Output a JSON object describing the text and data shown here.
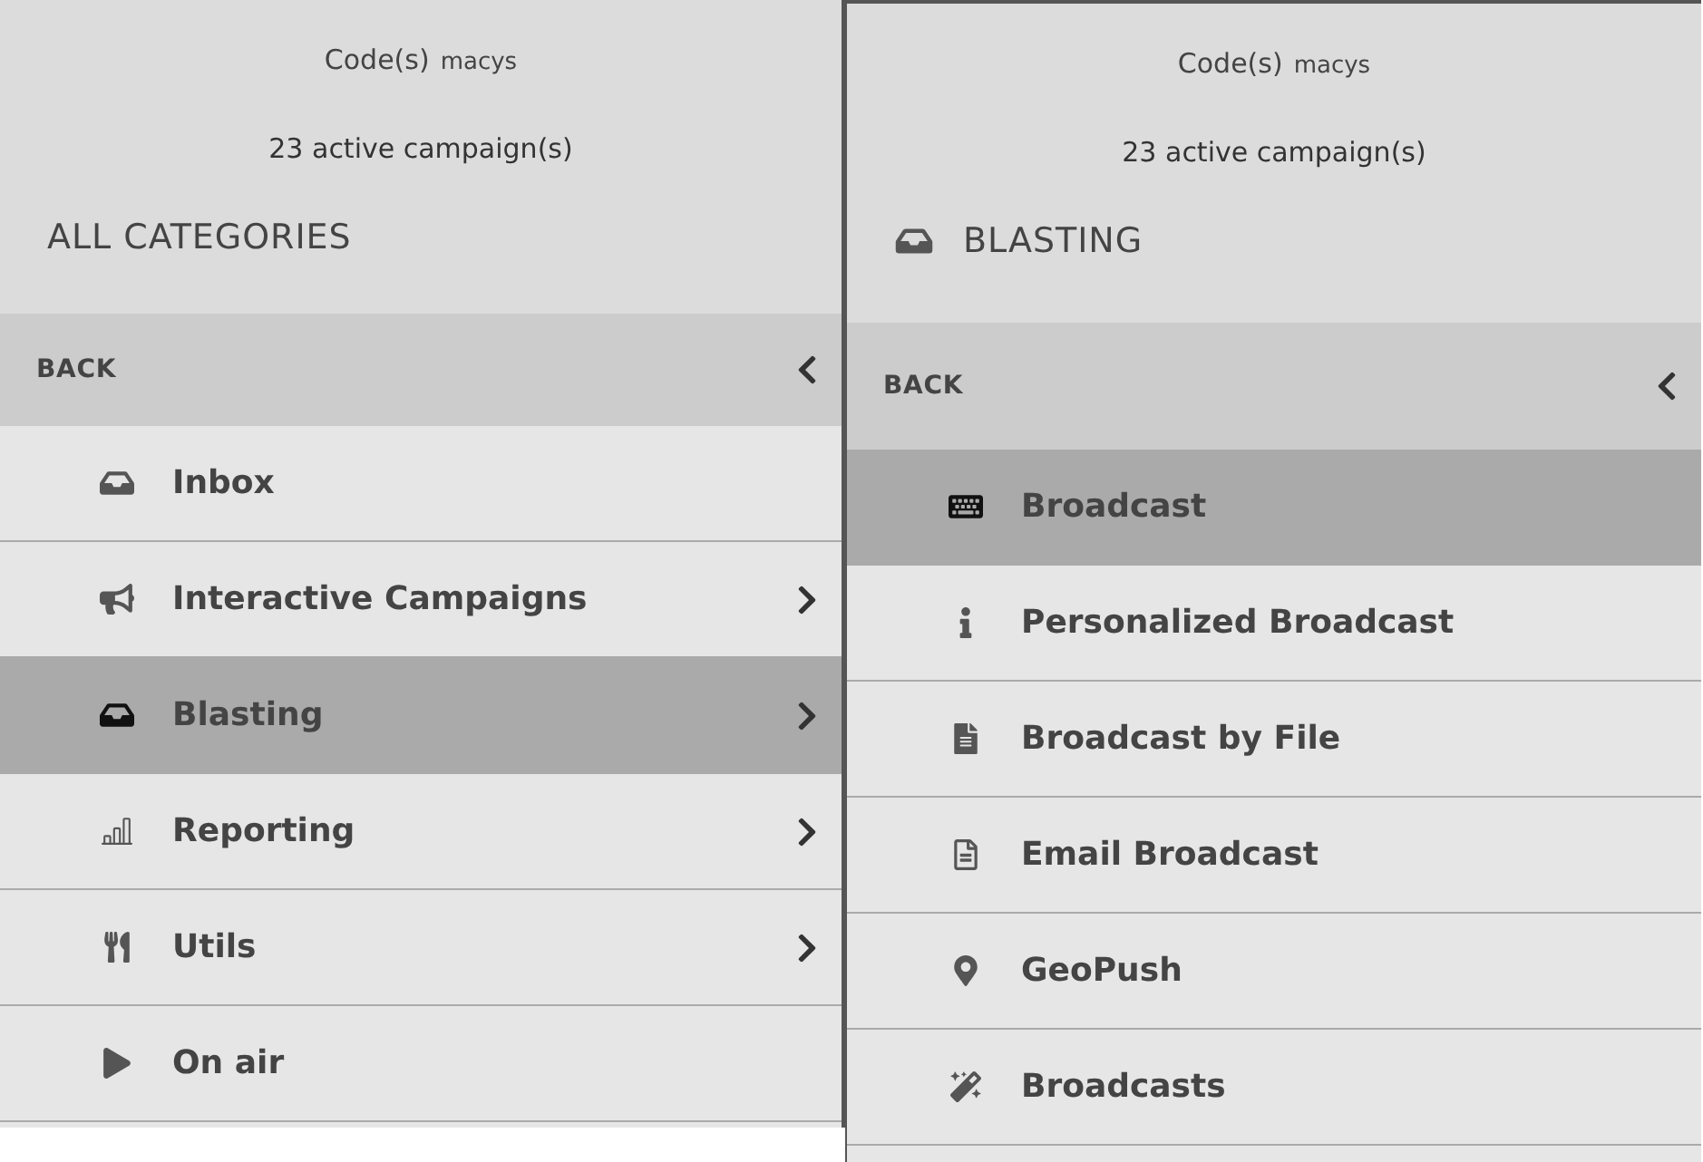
{
  "panels": [
    {
      "code_label": "Code(s)",
      "code_value": "macys",
      "campaigns": "23 active campaign(s)",
      "heading": "ALL CATEGORIES",
      "back": "BACK",
      "items": [
        {
          "label": "Inbox",
          "has_submenu": false,
          "selected": false
        },
        {
          "label": "Interactive Campaigns",
          "has_submenu": true,
          "selected": false
        },
        {
          "label": "Blasting",
          "has_submenu": true,
          "selected": true
        },
        {
          "label": "Reporting",
          "has_submenu": true,
          "selected": false
        },
        {
          "label": "Utils",
          "has_submenu": true,
          "selected": false
        },
        {
          "label": "On air",
          "has_submenu": false,
          "selected": false
        }
      ]
    },
    {
      "code_label": "Code(s)",
      "code_value": "macys",
      "campaigns": "23 active campaign(s)",
      "heading": "BLASTING",
      "back": "BACK",
      "items": [
        {
          "label": "Broadcast",
          "has_submenu": false,
          "selected": true
        },
        {
          "label": "Personalized Broadcast",
          "has_submenu": false,
          "selected": false
        },
        {
          "label": "Broadcast by File",
          "has_submenu": false,
          "selected": false
        },
        {
          "label": "Email Broadcast",
          "has_submenu": false,
          "selected": false
        },
        {
          "label": "GeoPush",
          "has_submenu": false,
          "selected": false
        },
        {
          "label": "Broadcasts",
          "has_submenu": false,
          "selected": false
        }
      ]
    }
  ]
}
